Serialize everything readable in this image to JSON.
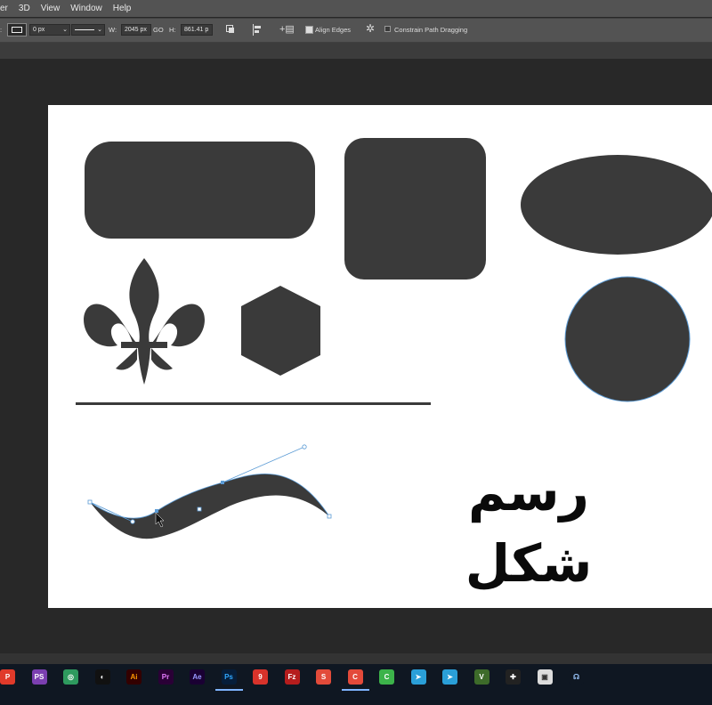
{
  "menubar": {
    "items": [
      "er",
      "3D",
      "View",
      "Window",
      "Help"
    ]
  },
  "options": {
    "stroke_width": "0 px",
    "width_label": "W:",
    "width_value": "2045 px",
    "link_label": "GO",
    "height_label": "H:",
    "height_value": "861.41 p",
    "align_edges": "Align Edges",
    "align_edges_checked": true,
    "constrain_path": "Constrain Path Dragging",
    "constrain_path_checked": false
  },
  "canvas": {
    "text_shape": "رسم شکل",
    "shape_fill": "#3a3a3a",
    "path_color": "#5b9bd5"
  },
  "taskbar": {
    "icons": [
      {
        "name": "p-app-icon",
        "label": "P",
        "bg": "#e03a2a",
        "fg": "#fff"
      },
      {
        "name": "phpstorm-icon",
        "label": "PS",
        "bg": "#7b3fb0",
        "fg": "#fff"
      },
      {
        "name": "globe-app-icon",
        "label": "◎",
        "bg": "#2e9a5e",
        "fg": "#fff"
      },
      {
        "name": "compass-icon",
        "label": "◐",
        "bg": "#111",
        "fg": "#fff"
      },
      {
        "name": "illustrator-icon",
        "label": "Ai",
        "bg": "#330000",
        "fg": "#ff9a00"
      },
      {
        "name": "premiere-icon",
        "label": "Pr",
        "bg": "#2a0036",
        "fg": "#e77bff"
      },
      {
        "name": "after-effects-icon",
        "label": "Ae",
        "bg": "#1a0033",
        "fg": "#9999ff"
      },
      {
        "name": "photoshop-icon",
        "label": "Ps",
        "bg": "#061e3a",
        "fg": "#31a8ff",
        "active": true
      },
      {
        "name": "swirl-app-icon",
        "label": "9",
        "bg": "#d8332b",
        "fg": "#fff"
      },
      {
        "name": "filezilla-icon",
        "label": "Fz",
        "bg": "#b51d1d",
        "fg": "#fff"
      },
      {
        "name": "s-app-icon",
        "label": "S",
        "bg": "#e24b3a",
        "fg": "#fff"
      },
      {
        "name": "camtasia-red-icon",
        "label": "C",
        "bg": "#e34a3a",
        "fg": "#fff",
        "active": true
      },
      {
        "name": "camtasia-green-icon",
        "label": "C",
        "bg": "#3cb34a",
        "fg": "#fff"
      },
      {
        "name": "telegram-icon",
        "label": "➤",
        "bg": "#2a9fd8",
        "fg": "#fff"
      },
      {
        "name": "telegram-2-icon",
        "label": "➤",
        "bg": "#2a9fd8",
        "fg": "#fff"
      },
      {
        "name": "v-app-icon",
        "label": "V",
        "bg": "#3d6b2a",
        "fg": "#fff"
      },
      {
        "name": "cross-app-icon",
        "label": "✚",
        "bg": "#222",
        "fg": "#fff"
      },
      {
        "name": "image-app-icon",
        "label": "▣",
        "bg": "#dcdcdc",
        "fg": "#333"
      },
      {
        "name": "headset-app-icon",
        "label": "☊",
        "bg": "#0f1722",
        "fg": "#9cc8ff"
      }
    ]
  }
}
